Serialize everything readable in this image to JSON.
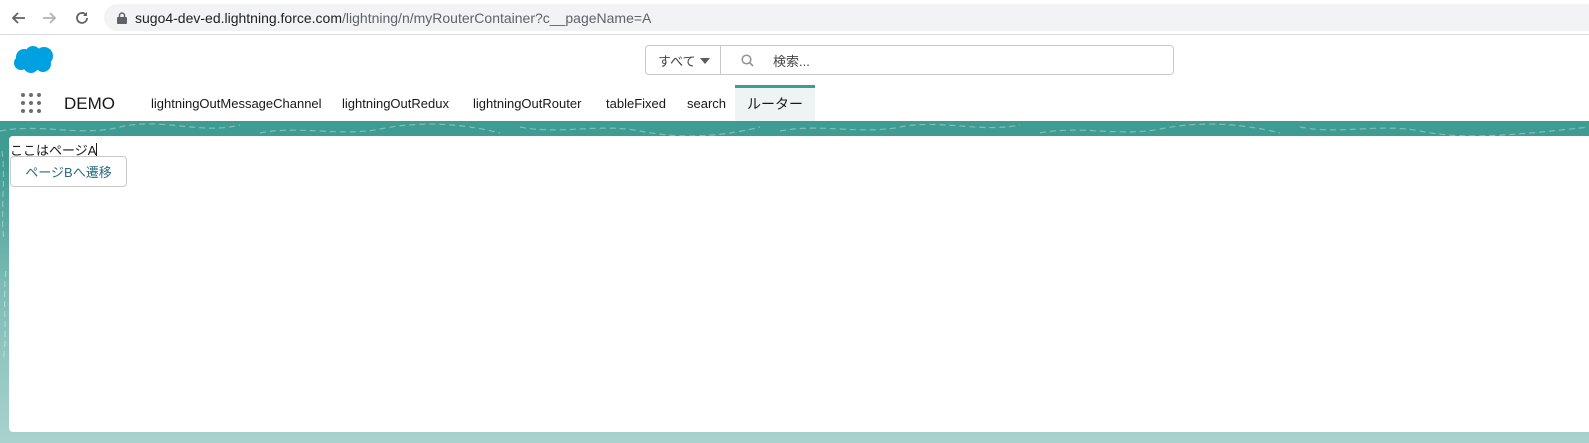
{
  "browser": {
    "url_host": "sugo4-dev-ed.lightning.force.com",
    "url_path": "/lightning/n/myRouterContainer?c__pageName=A"
  },
  "header": {
    "search_scope": "すべて",
    "search_placeholder": "検索..."
  },
  "nav": {
    "app_name": "DEMO",
    "tabs": [
      {
        "label": "lightningOutMessageChannel"
      },
      {
        "label": "lightningOutRedux"
      },
      {
        "label": "lightningOutRouter"
      },
      {
        "label": "tableFixed"
      },
      {
        "label": "search"
      },
      {
        "label": "ルーター",
        "active": true
      }
    ]
  },
  "page": {
    "text": "ここはページA",
    "button_label": "ページBへ遷移"
  },
  "colors": {
    "brand_teal": "#3f9c93",
    "logo_blue": "#00a1e0"
  }
}
